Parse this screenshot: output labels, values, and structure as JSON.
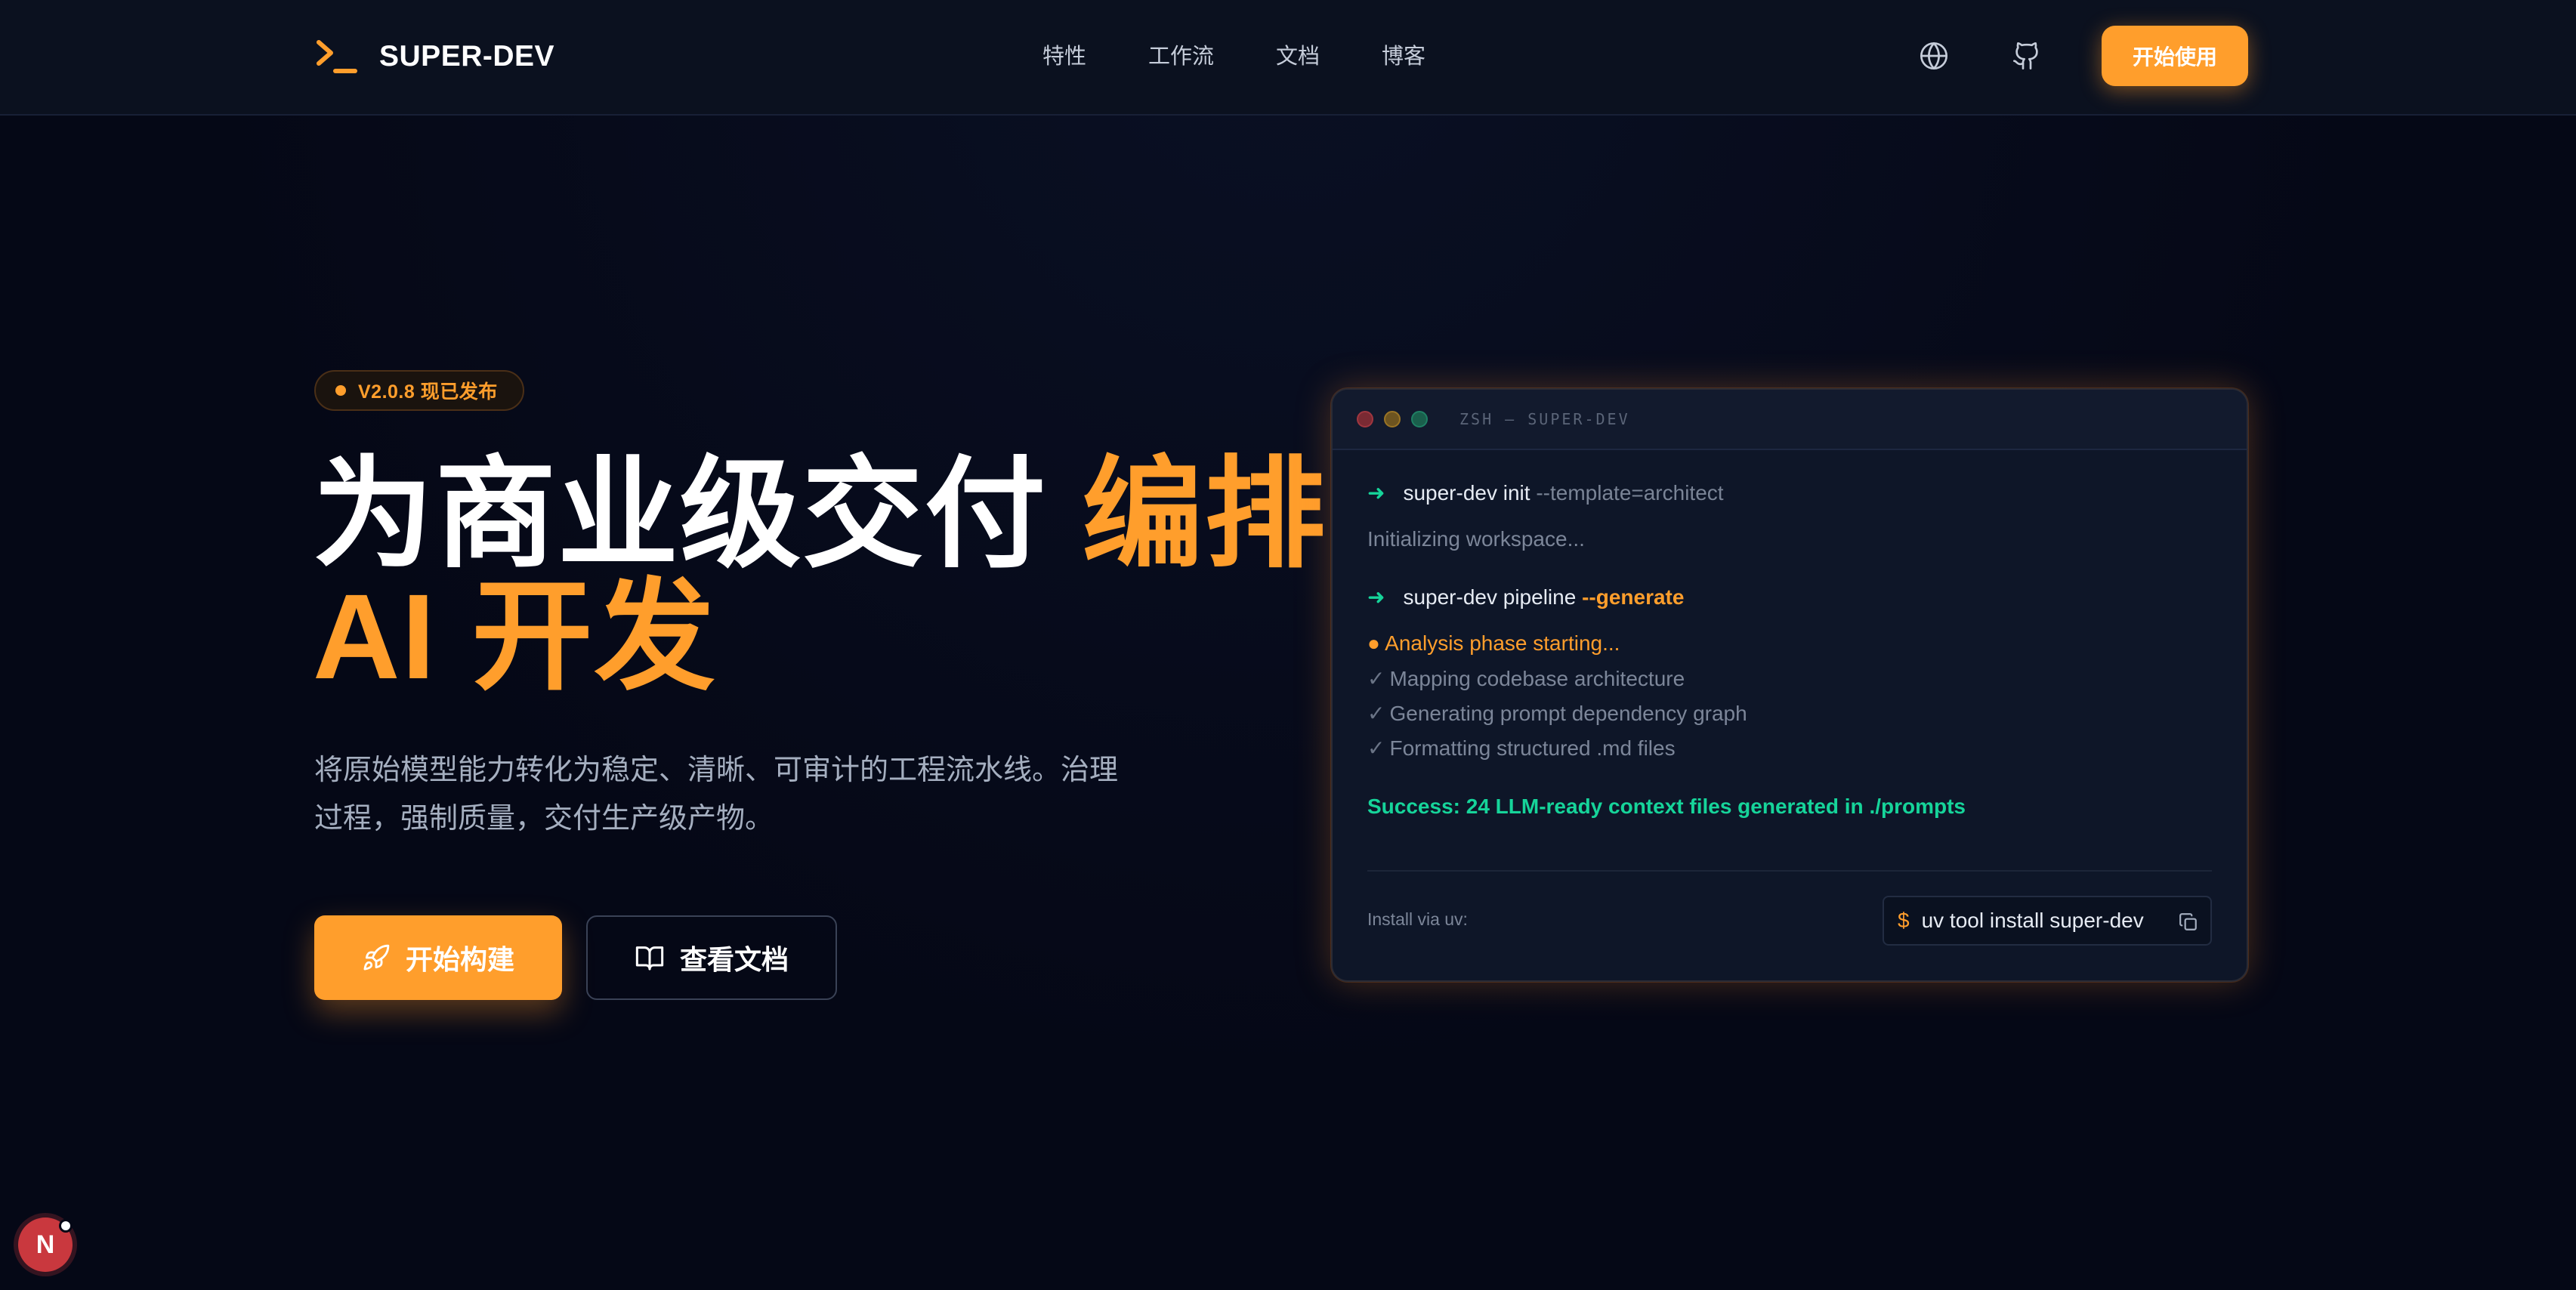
{
  "nav": {
    "brand_name": "SUPER-DEV",
    "links": [
      "特性",
      "工作流",
      "文档",
      "博客"
    ],
    "cta_label": "开始使用",
    "icons": [
      "globe-icon",
      "github-icon"
    ]
  },
  "hero": {
    "badge": "V2.0.8 现已发布",
    "title_white": "为商业级交付",
    "title_orange_1": "编排",
    "title_orange_2": "AI 开发",
    "description_line1": "将原始模型能力转化为稳定、清晰、可审计的工程流水线。治理",
    "description_line2": "过程，强制质量，交付生产级产物。",
    "primary_button": "开始构建",
    "secondary_button": "查看文档"
  },
  "terminal": {
    "title": "ZSH — SUPER-DEV",
    "cmd1": "super-dev init",
    "cmd1_arg": "--template=architect",
    "line_init": "Initializing workspace...",
    "cmd2": "super-dev pipeline",
    "cmd2_flag": "--generate",
    "analysis": "Analysis phase starting...",
    "checks": [
      "Mapping codebase architecture",
      "Generating prompt dependency graph",
      "Formatting structured .md files"
    ],
    "success": "Success: 24 LLM-ready context files generated in ./prompts",
    "install_label": "Install via uv:",
    "install_prompt": "$",
    "install_command": "uv tool install super-dev"
  },
  "floating": {
    "avatar_letter": "N"
  },
  "colors": {
    "accent": "#ff9e2c",
    "success": "#16d49a",
    "background": "#050816",
    "nav": "#0b111f",
    "terminal": "#0e1628"
  }
}
